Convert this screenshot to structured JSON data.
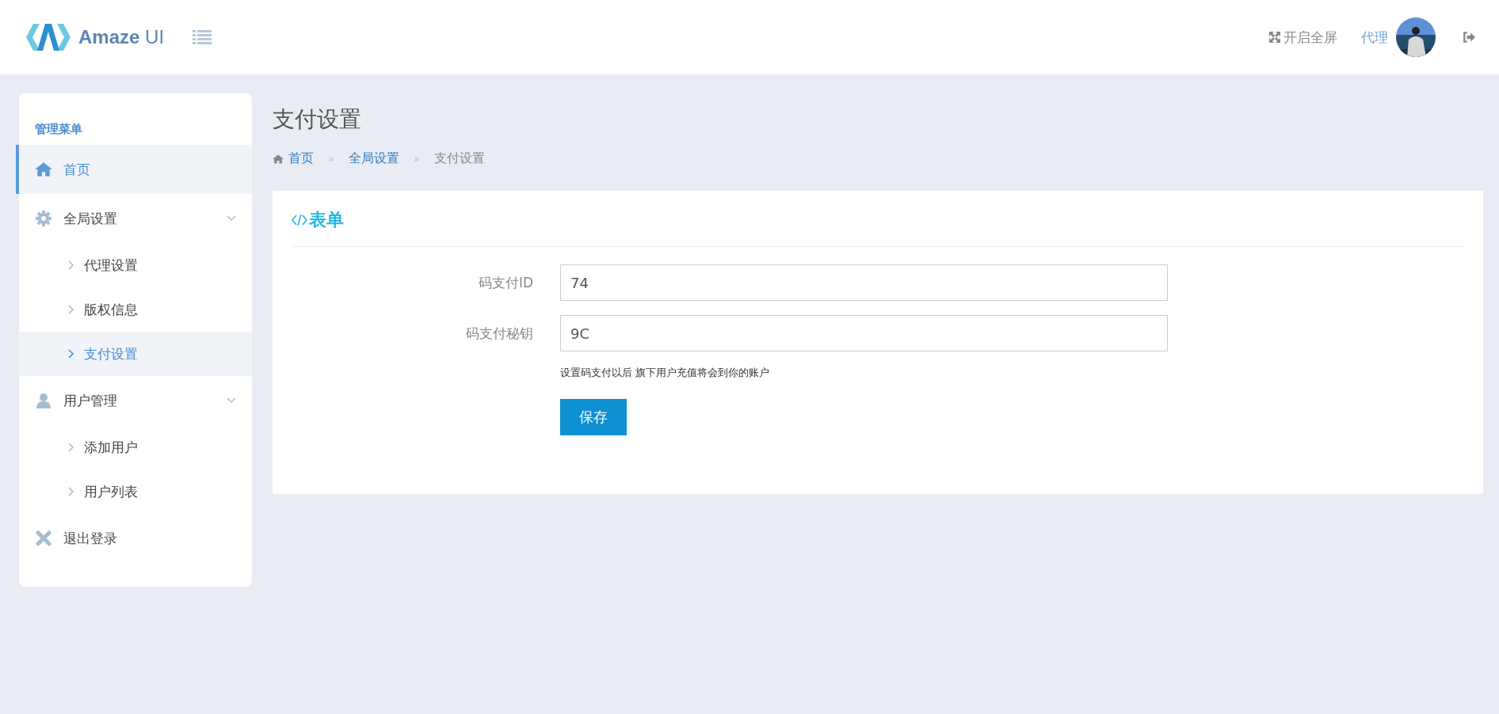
{
  "header": {
    "logo_text": "Amaze",
    "logo_suffix": "UI",
    "fullscreen": "开启全屏",
    "user": "代理"
  },
  "sidebar": {
    "title": "管理菜单",
    "items": [
      {
        "label": "首页",
        "selected": true
      },
      {
        "label": "全局设置",
        "selected": false,
        "expanded": true,
        "children": [
          {
            "label": "代理设置",
            "selected": false
          },
          {
            "label": "版权信息",
            "selected": false
          },
          {
            "label": "支付设置",
            "selected": true
          }
        ]
      },
      {
        "label": "用户管理",
        "selected": false,
        "expanded": true,
        "children": [
          {
            "label": "添加用户",
            "selected": false
          },
          {
            "label": "用户列表",
            "selected": false
          }
        ]
      },
      {
        "label": "退出登录",
        "selected": false
      }
    ]
  },
  "page": {
    "title": "支付设置",
    "breadcrumb": [
      "首页",
      "全局设置",
      "支付设置"
    ],
    "separator": "»"
  },
  "form": {
    "title": "表单",
    "fields": [
      {
        "label": "码支付ID",
        "value": "74"
      },
      {
        "label": "码支付秘钥",
        "value": "9C"
      }
    ],
    "hint": "设置码支付以后 旗下用户充值将会到你的账户",
    "submit": "保存"
  }
}
